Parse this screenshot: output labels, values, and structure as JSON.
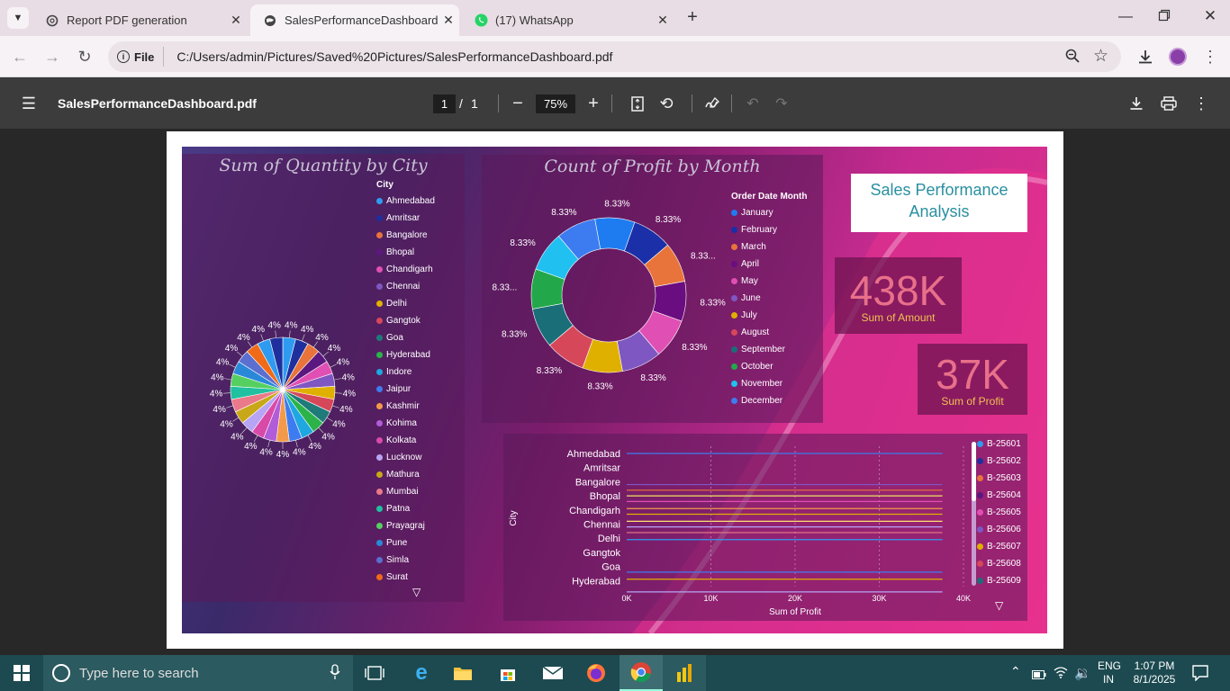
{
  "tabs": [
    {
      "title": "Report PDF generation",
      "icon": "chatgpt-icon",
      "active": false
    },
    {
      "title": "SalesPerformanceDashboard.pdf",
      "icon": "globe-icon",
      "active": true
    },
    {
      "title": "(17) WhatsApp",
      "icon": "whatsapp-icon",
      "active": false
    }
  ],
  "address": {
    "scheme_label": "File",
    "url": "C:/Users/admin/Pictures/Saved%20Pictures/SalesPerformanceDashboard.pdf"
  },
  "pdf": {
    "filename": "SalesPerformanceDashboard.pdf",
    "page_current": "1",
    "page_sep": "/",
    "page_total": "1",
    "zoom": "75%"
  },
  "report": {
    "title_line1": "Sales Performance",
    "title_line2": "Analysis",
    "kpi_amount": {
      "value": "438K",
      "label": "Sum of Amount"
    },
    "kpi_profit": {
      "value": "37K",
      "label": "Sum of Profit"
    }
  },
  "chart_data": [
    {
      "type": "pie",
      "title": "Sum of Quantity by City",
      "legend_title": "City",
      "categories": [
        "Ahmedabad",
        "Amritsar",
        "Bangalore",
        "Bhopal",
        "Chandigarh",
        "Chennai",
        "Delhi",
        "Gangtok",
        "Goa",
        "Hyderabad",
        "Indore",
        "Jaipur",
        "Kashmir",
        "Kohima",
        "Kolkata",
        "Lucknow",
        "Mathura",
        "Mumbai",
        "Patna",
        "Prayagraj",
        "Pune",
        "Simla",
        "Surat"
      ],
      "colors": [
        "#2f9bf0",
        "#1f2f9e",
        "#e8743b",
        "#5a1880",
        "#e04fb3",
        "#7e57c2",
        "#e0b000",
        "#d6475a",
        "#1f7a7a",
        "#2bb34a",
        "#1ea7e0",
        "#3d7cf0",
        "#f39a4a",
        "#b15cd8",
        "#d84aa8",
        "#b8a4f5",
        "#c8a818",
        "#ea7a8a",
        "#20c0a0",
        "#55d060",
        "#2a88d8",
        "#5a6fd0",
        "#f06a18"
      ],
      "values": [
        4,
        4,
        4,
        4,
        4,
        4,
        4,
        4,
        4,
        4,
        4,
        4,
        4,
        4,
        4,
        4,
        4,
        4,
        4,
        4,
        4,
        4,
        4,
        4,
        4
      ],
      "slice_labels": "4%"
    },
    {
      "type": "pie",
      "subtype": "donut",
      "title": "Count of Profit by Month",
      "legend_title": "Order Date Month",
      "categories": [
        "January",
        "February",
        "March",
        "April",
        "May",
        "June",
        "July",
        "August",
        "September",
        "October",
        "November",
        "December"
      ],
      "colors": [
        "#1e7cf0",
        "#1a2fa8",
        "#e8743b",
        "#6a0d80",
        "#e04fb3",
        "#7e57c2",
        "#e0b000",
        "#d6475a",
        "#1a6e78",
        "#22a84a",
        "#20c0f0",
        "#3d7cf0"
      ],
      "values": [
        8.33,
        8.33,
        8.33,
        8.33,
        8.33,
        8.33,
        8.33,
        8.33,
        8.33,
        8.33,
        8.33,
        8.33
      ],
      "slice_labels": [
        "8.33%",
        "8.33%",
        "8.33...",
        "8.33%",
        "8.33%",
        "8.33%",
        "8.33%",
        "8.33%",
        "8.33%",
        "8.33...",
        "8.33%",
        "8.33%"
      ]
    },
    {
      "type": "line",
      "orientation": "horizontal",
      "xlabel": "Sum of Profit",
      "ylabel": "City",
      "xlim": [
        0,
        40000
      ],
      "x_ticks": [
        "0K",
        "10K",
        "20K",
        "30K",
        "40K"
      ],
      "categories": [
        "Ahmedabad",
        "Amritsar",
        "Bangalore",
        "Bhopal",
        "Chandigarh",
        "Chennai",
        "Delhi",
        "Gangtok",
        "Goa",
        "Hyderabad"
      ],
      "series": [
        {
          "name": "B-25601",
          "color": "#2f9bf0"
        },
        {
          "name": "B-25602",
          "color": "#1f2f9e"
        },
        {
          "name": "B-25603",
          "color": "#e8743b"
        },
        {
          "name": "B-25604",
          "color": "#5a1880"
        },
        {
          "name": "B-25605",
          "color": "#e04fb3"
        },
        {
          "name": "B-25606",
          "color": "#7e57c2"
        },
        {
          "name": "B-25607",
          "color": "#e0b000"
        },
        {
          "name": "B-25608",
          "color": "#d6475a"
        },
        {
          "name": "B-25609",
          "color": "#1a6e78"
        }
      ]
    }
  ],
  "taskbar": {
    "search_placeholder": "Type here to search",
    "lang": "ENG",
    "region": "IN",
    "time": "1:07 PM",
    "date": "8/1/2025"
  }
}
